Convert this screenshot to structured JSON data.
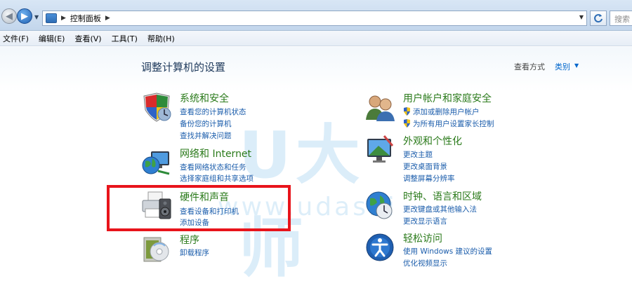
{
  "addressbar": {
    "path_root": "控制面板",
    "search_placeholder": "搜索"
  },
  "menu": [
    "文件(F)",
    "编辑(E)",
    "查看(V)",
    "工具(T)",
    "帮助(H)"
  ],
  "page": {
    "title": "调整计算机的设置",
    "view_by_label": "查看方式",
    "view_by_value": "类别"
  },
  "watermark": {
    "big": "U大师",
    "url": "www.udashi"
  },
  "categories": {
    "system_security": {
      "title": "系统和安全",
      "links": [
        "查看您的计算机状态",
        "备份您的计算机",
        "查找并解决问题"
      ]
    },
    "network": {
      "title": "网络和 Internet",
      "links": [
        "查看网络状态和任务",
        "选择家庭组和共享选项"
      ]
    },
    "hardware": {
      "title": "硬件和声音",
      "links": [
        "查看设备和打印机",
        "添加设备"
      ]
    },
    "programs": {
      "title": "程序",
      "links": [
        "卸载程序"
      ]
    },
    "user_accounts": {
      "title": "用户帐户和家庭安全",
      "links": [
        "添加或删除用户帐户",
        "为所有用户设置家长控制"
      ]
    },
    "appearance": {
      "title": "外观和个性化",
      "links": [
        "更改主题",
        "更改桌面背景",
        "调整屏幕分辨率"
      ]
    },
    "clock": {
      "title": "时钟、语言和区域",
      "links": [
        "更改键盘或其他输入法",
        "更改显示语言"
      ]
    },
    "ease": {
      "title": "轻松访问",
      "links": [
        "使用 Windows 建议的设置",
        "优化视频显示"
      ]
    }
  },
  "colors": {
    "category_title": "#2a7a1a",
    "link": "#1a5cab",
    "highlight": "#e8141b"
  }
}
